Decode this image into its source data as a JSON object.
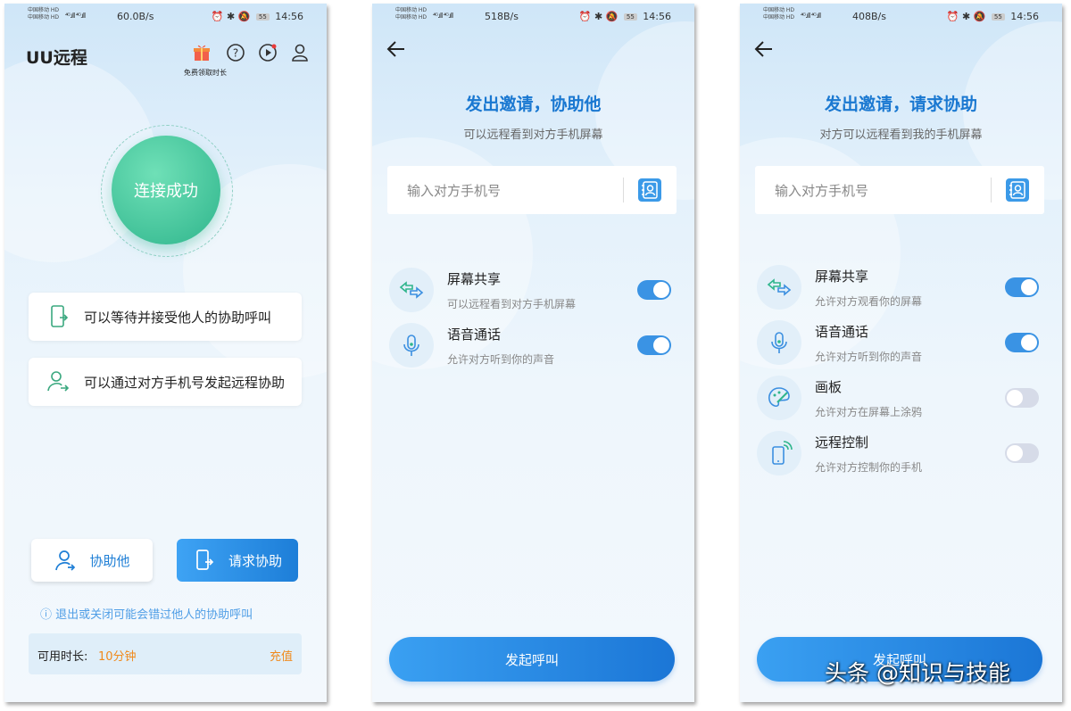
{
  "phone1": {
    "status": {
      "carrier1": "中国移动 HD",
      "carrier2": "中国移动 HD",
      "signal": "⁴ᴳ.ıll ⁴ᴳ.ıll",
      "speed": "60.0B/s",
      "battery": "55",
      "time": "14:56"
    },
    "app_title": "UU远程",
    "gift_label": "免费领取时长",
    "status_circle": "连接成功",
    "info_cards": [
      {
        "label": "可以等待并接受他人的协助呼叫",
        "icon": "phone-incoming-icon"
      },
      {
        "label": "可以通过对方手机号发起远程协助",
        "icon": "user-arrow-icon"
      }
    ],
    "buttons": {
      "help_others": "协助他",
      "request_help": "请求协助"
    },
    "warning": "ⓘ 退出或关闭可能会错过他人的协助呼叫",
    "balance": {
      "label": "可用时长:",
      "value": "10分钟",
      "recharge": "充值"
    }
  },
  "phone2": {
    "status": {
      "carrier1": "中国移动 HD",
      "carrier2": "中国移动 HD",
      "signal": "⁴ᴳ.ıll ⁴ᴳ.ıll",
      "speed": "518B/s",
      "battery": "55",
      "time": "14:56"
    },
    "title": "发出邀请，协助他",
    "subtitle": "可以远程看到对方手机屏幕",
    "phone_placeholder": "输入对方手机号",
    "features": [
      {
        "name": "屏幕共享",
        "desc": "可以远程看到对方手机屏幕",
        "enabled": true,
        "icon": "screen-share-icon"
      },
      {
        "name": "语音通话",
        "desc": "允许对方听到你的声音",
        "enabled": true,
        "icon": "microphone-icon"
      }
    ],
    "call_button": "发起呼叫"
  },
  "phone3": {
    "status": {
      "carrier1": "中国移动 HD",
      "carrier2": "中国移动 HD",
      "signal": "⁴ᴳ.ıll ⁴ᴳ.ıll",
      "speed": "408B/s",
      "battery": "55",
      "time": "14:56"
    },
    "title": "发出邀请，请求协助",
    "subtitle": "对方可以远程看到我的手机屏幕",
    "phone_placeholder": "输入对方手机号",
    "features": [
      {
        "name": "屏幕共享",
        "desc": "允许对方观看你的屏幕",
        "enabled": true,
        "icon": "screen-share-icon"
      },
      {
        "name": "语音通话",
        "desc": "允许对方听到你的声音",
        "enabled": true,
        "icon": "microphone-icon"
      },
      {
        "name": "画板",
        "desc": "允许对方在屏幕上涂鸦",
        "enabled": false,
        "icon": "palette-icon"
      },
      {
        "name": "远程控制",
        "desc": "允许对方控制你的手机",
        "enabled": false,
        "icon": "remote-control-icon"
      }
    ],
    "call_button": "发起呼叫"
  },
  "watermark": "头条 @知识与技能",
  "colors": {
    "accent_blue": "#1a78d1",
    "green": "#2fb58c",
    "orange": "#f08a1c",
    "toggle_on": "#3a93e4",
    "toggle_off": "#d6dbe8"
  }
}
